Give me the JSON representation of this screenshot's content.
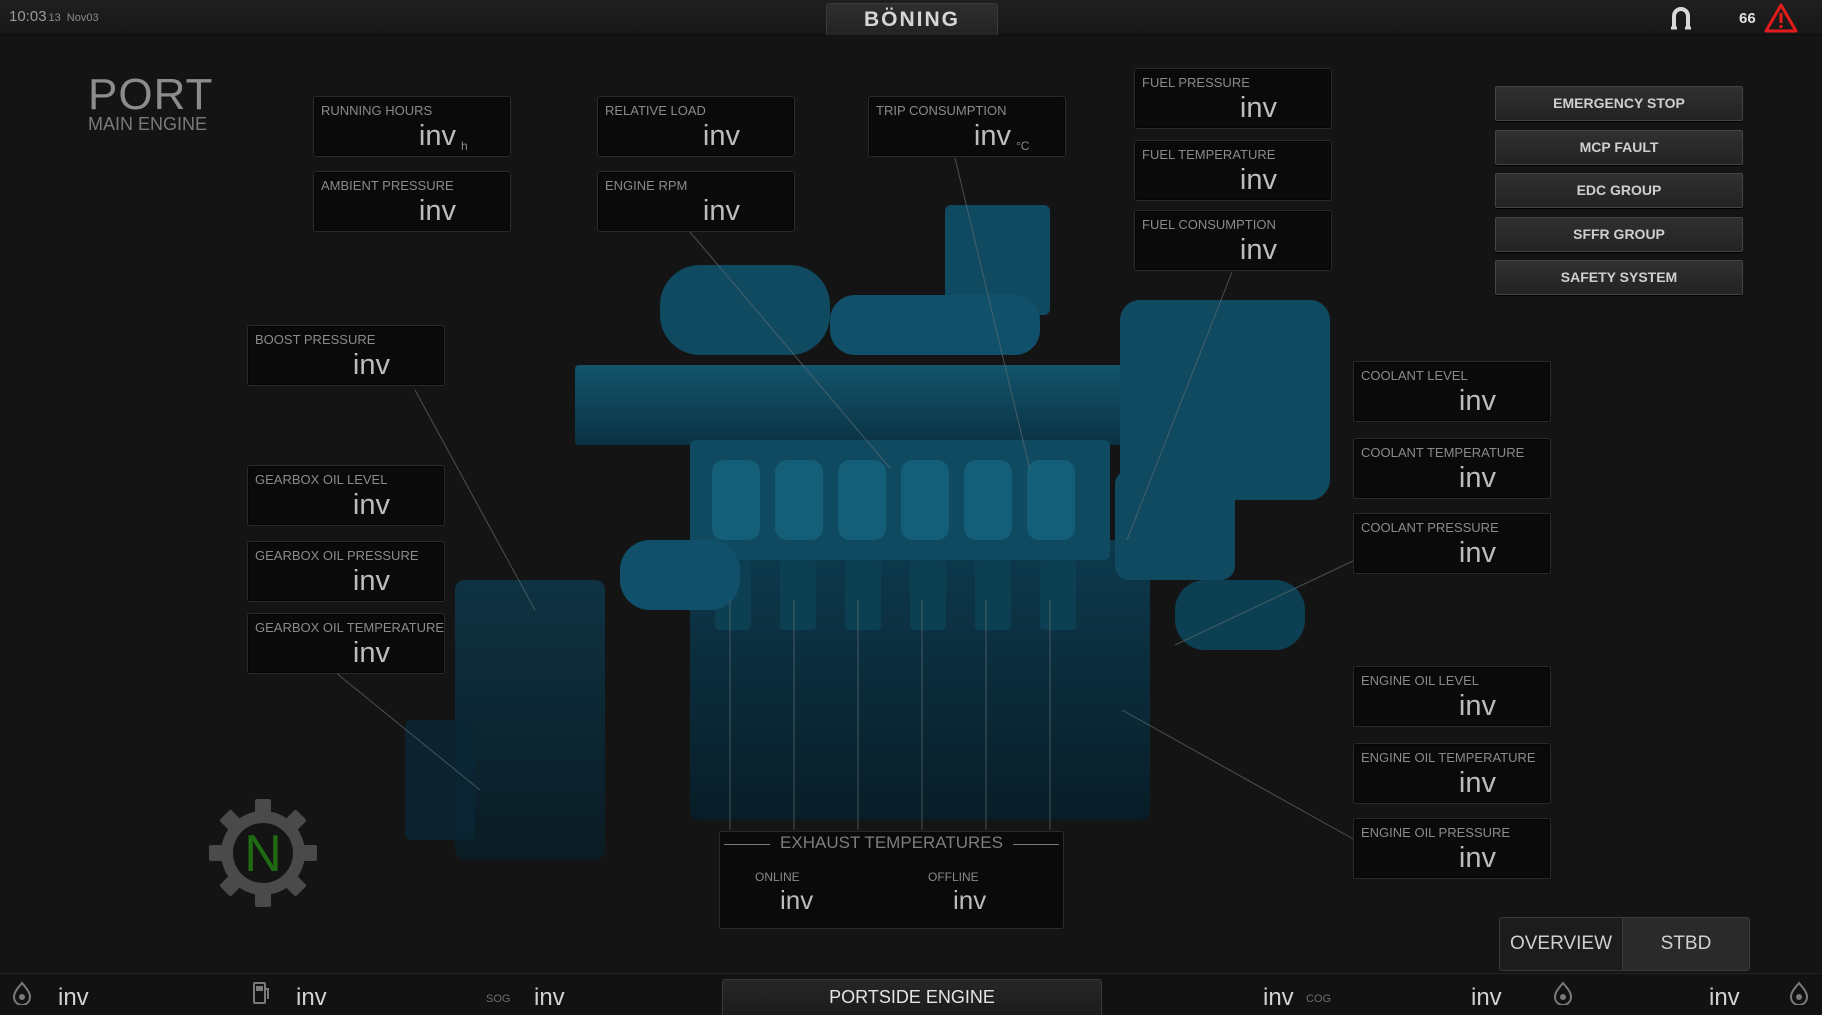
{
  "topbar": {
    "time": "10:03",
    "seconds": "13",
    "date": "Nov03",
    "brand": "BÖNING",
    "alarm_count": "66",
    "icons": [
      "horseshoe-icon",
      "warning-triangle-icon"
    ]
  },
  "title": {
    "main": "PORT",
    "sub": "MAIN ENGINE"
  },
  "panels": {
    "running_hours": {
      "label": "RUNNING HOURS",
      "value": "inv",
      "unit": "h"
    },
    "ambient_pressure": {
      "label": "AMBIENT PRESSURE",
      "value": "inv"
    },
    "relative_load": {
      "label": "RELATIVE LOAD",
      "value": "inv"
    },
    "engine_rpm": {
      "label": "ENGINE RPM",
      "value": "inv"
    },
    "trip_consumption": {
      "label": "TRIP CONSUMPTION",
      "value": "inv",
      "unit": "°C"
    },
    "fuel_pressure": {
      "label": "FUEL PRESSURE",
      "value": "inv"
    },
    "fuel_temperature": {
      "label": "FUEL TEMPERATURE",
      "value": "inv"
    },
    "fuel_consumption": {
      "label": "FUEL CONSUMPTION",
      "value": "inv"
    },
    "boost_pressure": {
      "label": "BOOST PRESSURE",
      "value": "inv"
    },
    "gearbox_oil_level": {
      "label": "GEARBOX OIL LEVEL",
      "value": "inv"
    },
    "gearbox_oil_pressure": {
      "label": "GEARBOX OIL PRESSURE",
      "value": "inv"
    },
    "gearbox_oil_temperature": {
      "label": "GEARBOX OIL TEMPERATURE",
      "value": "inv"
    },
    "coolant_level": {
      "label": "COOLANT LEVEL",
      "value": "inv"
    },
    "coolant_temperature": {
      "label": "COOLANT TEMPERATURE",
      "value": "inv"
    },
    "coolant_pressure": {
      "label": "COOLANT PRESSURE",
      "value": "inv"
    },
    "engine_oil_level": {
      "label": "ENGINE OIL LEVEL",
      "value": "inv"
    },
    "engine_oil_temperature": {
      "label": "ENGINE OIL TEMPERATURE",
      "value": "inv"
    },
    "engine_oil_pressure": {
      "label": "ENGINE OIL PRESSURE",
      "value": "inv"
    }
  },
  "side_buttons": [
    "EMERGENCY STOP",
    "MCP FAULT",
    "EDC GROUP",
    "SFFR GROUP",
    "SAFETY SYSTEM"
  ],
  "exhaust": {
    "title": "EXHAUST TEMPERATURES",
    "online_label": "ONLINE",
    "online_value": "inv",
    "offline_label": "OFFLINE",
    "offline_value": "inv"
  },
  "gear": {
    "value": "N",
    "color": "#1f6b12"
  },
  "tabs": [
    "OVERVIEW",
    "STBD"
  ],
  "bottombar": {
    "v1": "inv",
    "v2": "inv",
    "sog_label": "SOG",
    "v3": "inv",
    "center": "PORTSIDE ENGINE",
    "v4": "inv",
    "cog_label": "COG",
    "v5": "inv",
    "v6": "inv"
  },
  "colors": {
    "engine": "#0f4a60",
    "engine_dark": "#0a3446",
    "accent_text": "#bcbcbc",
    "warning": "#e31b1b",
    "gear_n": "#1f6b12"
  }
}
